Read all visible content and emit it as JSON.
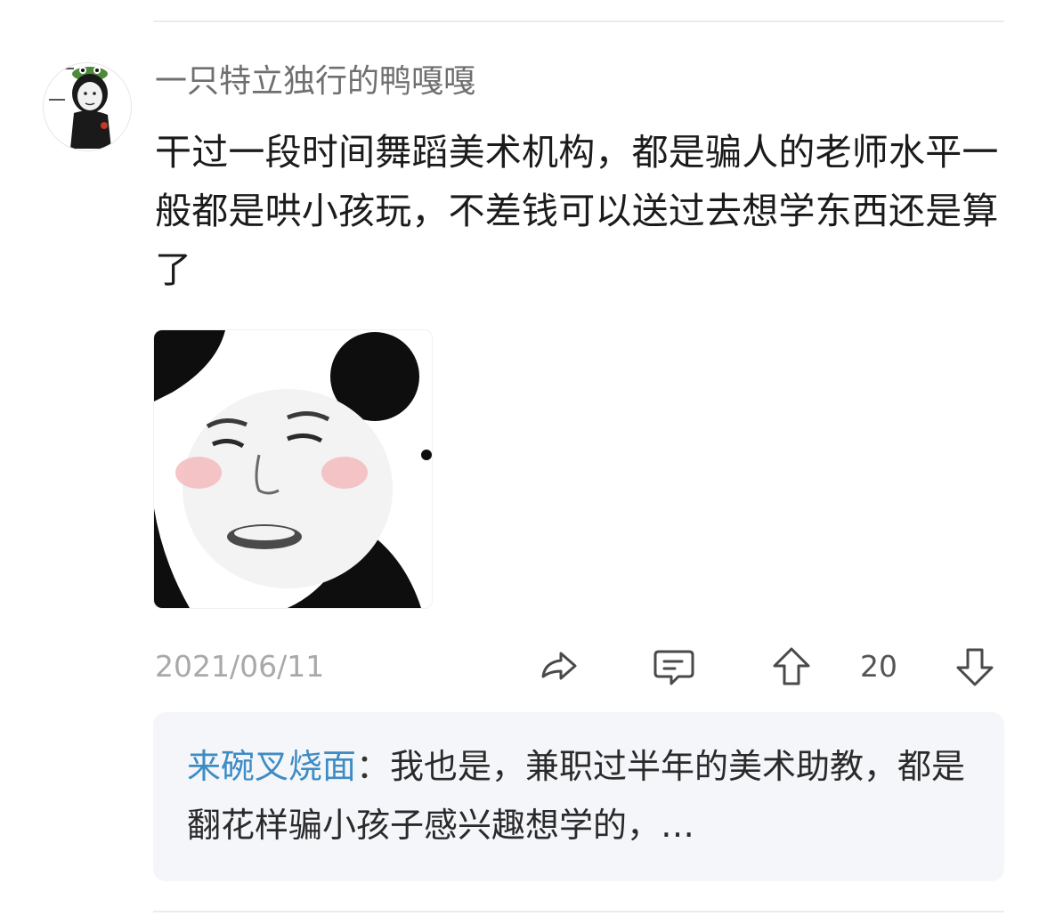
{
  "comment": {
    "username": "一只特立独行的鸭嘎嘎",
    "text": "干过一段时间舞蹈美术机构，都是骗人的老师水平一般都是哄小孩玩，不差钱可以送过去想学东西还是算了",
    "date": "2021/06/11",
    "like_count": "20"
  },
  "reply": {
    "author": "来碗叉烧面",
    "separator": "：",
    "text": "我也是，兼职过半年的美术助教，都是翻花样骗小孩子感兴趣想学的，…"
  },
  "icons": {
    "share": "share-icon",
    "comment": "comment-icon",
    "upvote": "upvote-icon",
    "downvote": "downvote-icon"
  },
  "colors": {
    "username": "#6f6f6f",
    "reply_author": "#3d8cc4",
    "reply_background": "#f5f6fa",
    "date": "#a9a9a9"
  }
}
